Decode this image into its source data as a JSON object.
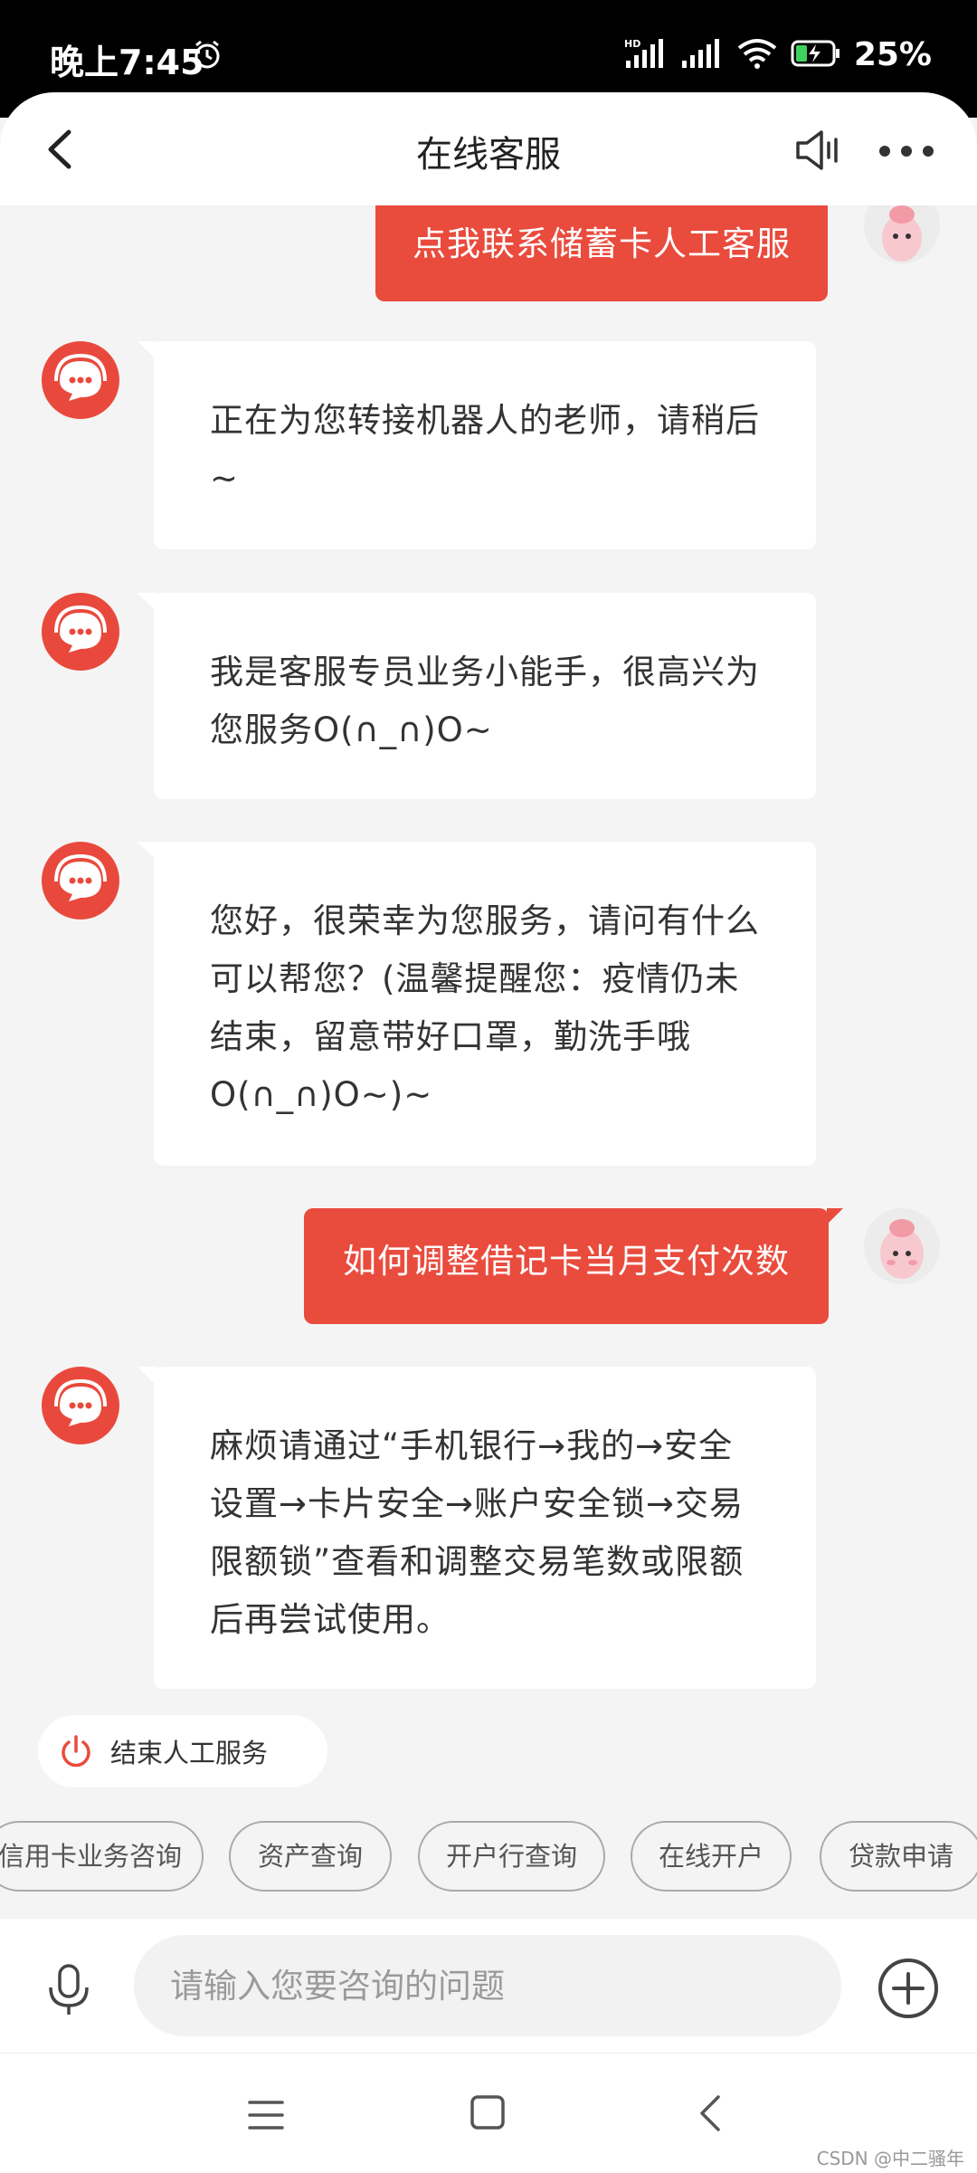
{
  "status_bar": {
    "time": "晚上7:45",
    "battery": "25%",
    "hd_label": "HD"
  },
  "header": {
    "title": "在线客服"
  },
  "messages": [
    {
      "from": "user",
      "text": "点我联系储蓄卡人工客服"
    },
    {
      "from": "bot",
      "text": "正在为您转接机器人的老师，请稍后~"
    },
    {
      "from": "bot",
      "text": "我是客服专员业务小能手，很高兴为您服务O(∩_∩)O~"
    },
    {
      "from": "bot",
      "text": "您好，很荣幸为您服务，请问有什么可以帮您？(温馨提醒您：疫情仍未结束，留意带好口罩，勤洗手哦O(∩_∩)O~)~"
    },
    {
      "from": "user",
      "text": "如何调整借记卡当月支付次数"
    },
    {
      "from": "bot",
      "text": "麻烦请通过“手机银行→我的→安全设置→卡片安全→账户安全锁→交易限额锁”查看和调整交易笔数或限额后再尝试使用。"
    }
  ],
  "end_service": {
    "label": "结束人工服务"
  },
  "quick_replies": [
    "信用卡业务咨询",
    "资产查询",
    "开户行查询",
    "在线开户",
    "贷款申请"
  ],
  "input": {
    "placeholder": "请输入您要咨询的问题",
    "value": ""
  },
  "watermark": "CSDN @中二骚年",
  "colors": {
    "accent": "#e94b3d",
    "background": "#f4f4f4"
  },
  "icons": [
    "back-arrow-icon",
    "speaker-icon",
    "more-icon",
    "microphone-icon",
    "plus-icon",
    "power-icon",
    "menu-icon",
    "home-icon",
    "nav-back-icon"
  ]
}
